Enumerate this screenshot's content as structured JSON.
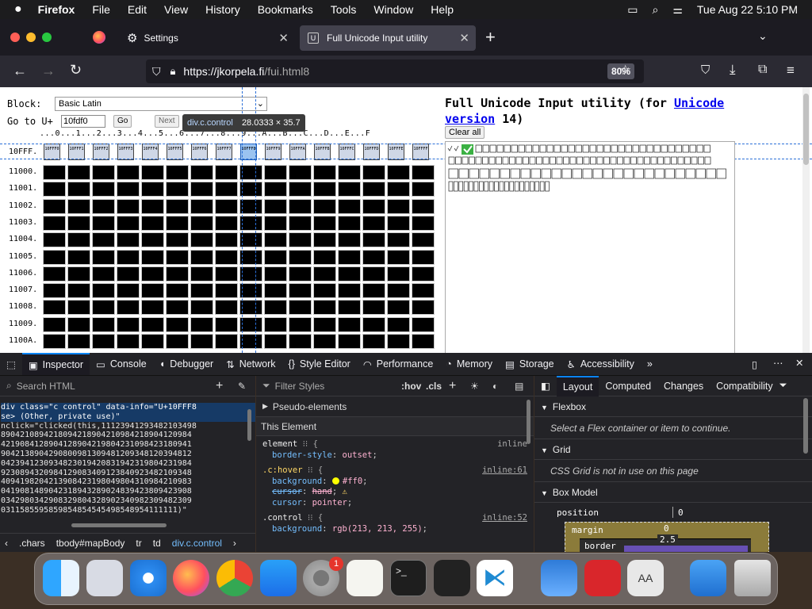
{
  "menubar": {
    "app": "Firefox",
    "items": [
      "File",
      "Edit",
      "View",
      "History",
      "Bookmarks",
      "Tools",
      "Window",
      "Help"
    ],
    "clock": "Tue Aug 22  5:10 PM"
  },
  "tabs": [
    {
      "label": "Settings",
      "icon": "gear-icon"
    },
    {
      "label": "Full Unicode Input utility",
      "icon": "page-icon"
    }
  ],
  "url": {
    "host": "https://jkorpela.fi",
    "path": "/fui.html8",
    "zoom": "80%"
  },
  "page": {
    "block_label": "Block:",
    "block_value": "Basic Latin",
    "goto_label": "Go to U+",
    "goto_value": "10fdf0",
    "go_button": "Go",
    "next_button": "Next",
    "column_header": "...0...1...2...3...4...5...6...7...8...9...A...B...C...D...E...F",
    "first_row_label": "10FFF.",
    "row_labels": [
      "11000.",
      "11001.",
      "11002.",
      "11003.",
      "11004.",
      "11005.",
      "11006.",
      "11007.",
      "11008.",
      "11009.",
      "1100A."
    ],
    "glyph_codes": [
      "10FFF0",
      "10FFF1",
      "10FFF2",
      "10FFF3",
      "10FFF4",
      "10FFF5",
      "10FFF6",
      "10FFF7",
      "10FFF8",
      "10FFF9",
      "10FFFA",
      "10FFFB",
      "10FFFC",
      "10FFFD",
      "10FFFE",
      "10FFFF"
    ],
    "tooltip_name": "div.c.control",
    "tooltip_size": "28.0333 × 35.7",
    "title_a": "Full Unicode Input utility (for ",
    "title_link": "Unicode",
    "title_b": "version",
    "title_c": " 14)",
    "clear_button": "Clear all"
  },
  "devtools": {
    "tabs": [
      "Inspector",
      "Console",
      "Debugger",
      "Network",
      "Style Editor",
      "Performance",
      "Memory",
      "Storage",
      "Accessibility"
    ],
    "search_html_placeholder": "Search HTML",
    "html_lines": [
      "div class=\"c control\" data-info=\"U+10FFF8",
      "se> (Other, private use)\"",
      "nclick=\"clicked(this,11123941293482103498",
      "8904210894218094218904210984218904120984",
      "4219084128904128904219804231098423180941",
      "9042138904290800981309481209348120394812",
      "0423941230934823019420831942319804231984",
      "9230894320984129083409123840923482109348",
      "4094198204213908423198049804310984210983",
      "0419081489042318943289024839423809423908",
      "0342980342908329804328902340982309482309",
      "0311585595859854854545498548954111111)\""
    ],
    "breadcrumbs": [
      ".chars",
      "tbody#mapBody",
      "tr",
      "td",
      "div.c.control"
    ],
    "filter_placeholder": "Filter Styles",
    "hov": ":hov",
    "cls": ".cls",
    "pseudo": "Pseudo-elements",
    "this_element": "This Element",
    "rules": [
      {
        "selector": "element",
        "source": "inline",
        "props": [
          {
            "name": "border-style",
            "value": "outset"
          }
        ]
      },
      {
        "selector": ".c:hover",
        "source": "inline:61",
        "props": [
          {
            "name": "background",
            "value": "#ff0"
          },
          {
            "name": "cursor",
            "value": "hand"
          },
          {
            "name": "cursor",
            "value": "pointer"
          }
        ]
      },
      {
        "selector": ".control",
        "source": "inline:52",
        "props": [
          {
            "name": "background",
            "value": "rgb(213, 213, 255)"
          }
        ]
      }
    ],
    "layout_tabs": [
      "Layout",
      "Computed",
      "Changes",
      "Compatibility"
    ],
    "flexbox_title": "Flexbox",
    "flexbox_msg": "Select a Flex container or item to continue.",
    "grid_title": "Grid",
    "grid_msg": "CSS Grid is not in use on this page",
    "boxmodel_title": "Box Model",
    "position_label": "position",
    "position_value": "0",
    "margin_label": "margin",
    "margin_value": "0",
    "border_label": "border",
    "border_value": "2.5"
  },
  "dock": {
    "badge": "1"
  },
  "colors": {
    "accent": "#0a84ff",
    "hover_yellow": "#ffff00",
    "highlight": "#9ac3f0"
  }
}
